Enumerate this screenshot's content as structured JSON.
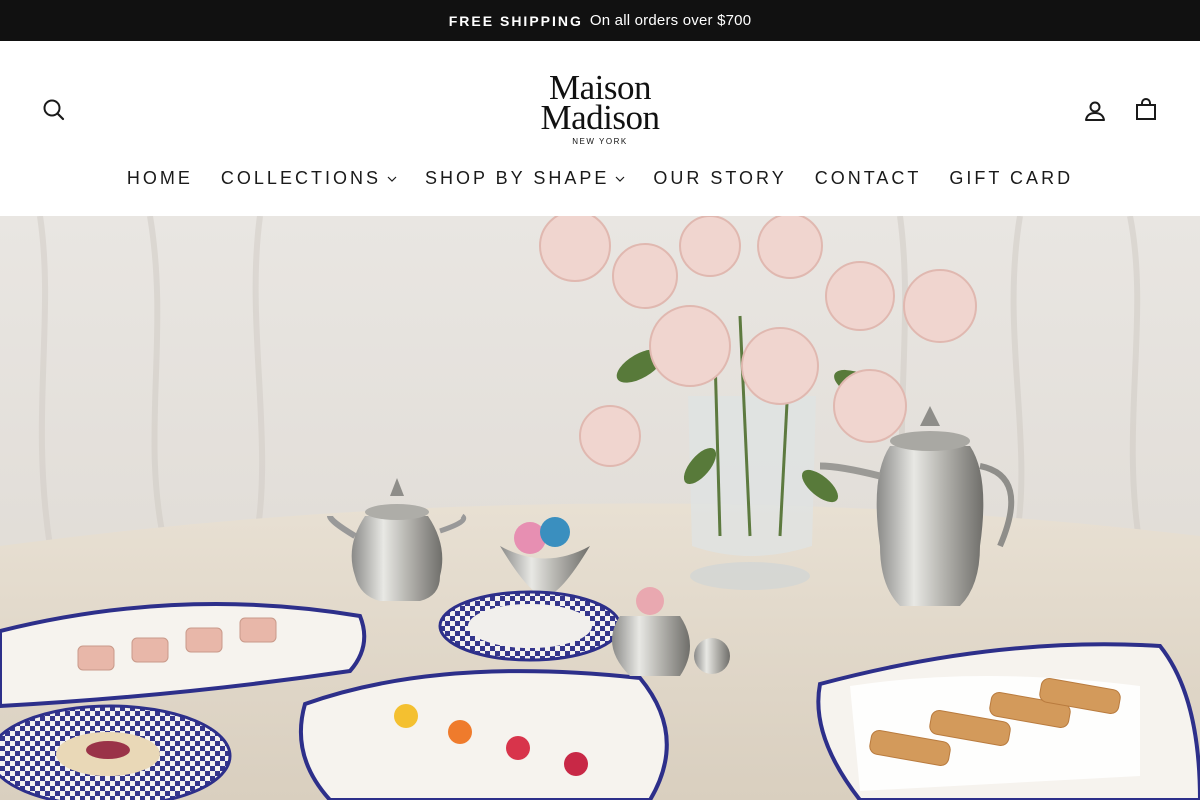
{
  "announcement": {
    "bold": "FREE SHIPPING",
    "text": "On all orders over $700"
  },
  "brand": {
    "line1": "Maison",
    "line2": "Madison",
    "line3": "NEW YORK"
  },
  "nav": {
    "home": "HOME",
    "collections": "COLLECTIONS",
    "shop_by_shape": "SHOP BY SHAPE",
    "our_story": "OUR STORY",
    "contact": "CONTACT",
    "gift_card": "GIFT CARD"
  },
  "icons": {
    "search": "search-icon",
    "account": "user-icon",
    "cart": "shopping-bag-icon",
    "dropdown": "chevron-down-icon"
  },
  "colors": {
    "announce_bg": "#111111",
    "accent_blue": "#2d2f8a",
    "text": "#1a1a1a"
  }
}
